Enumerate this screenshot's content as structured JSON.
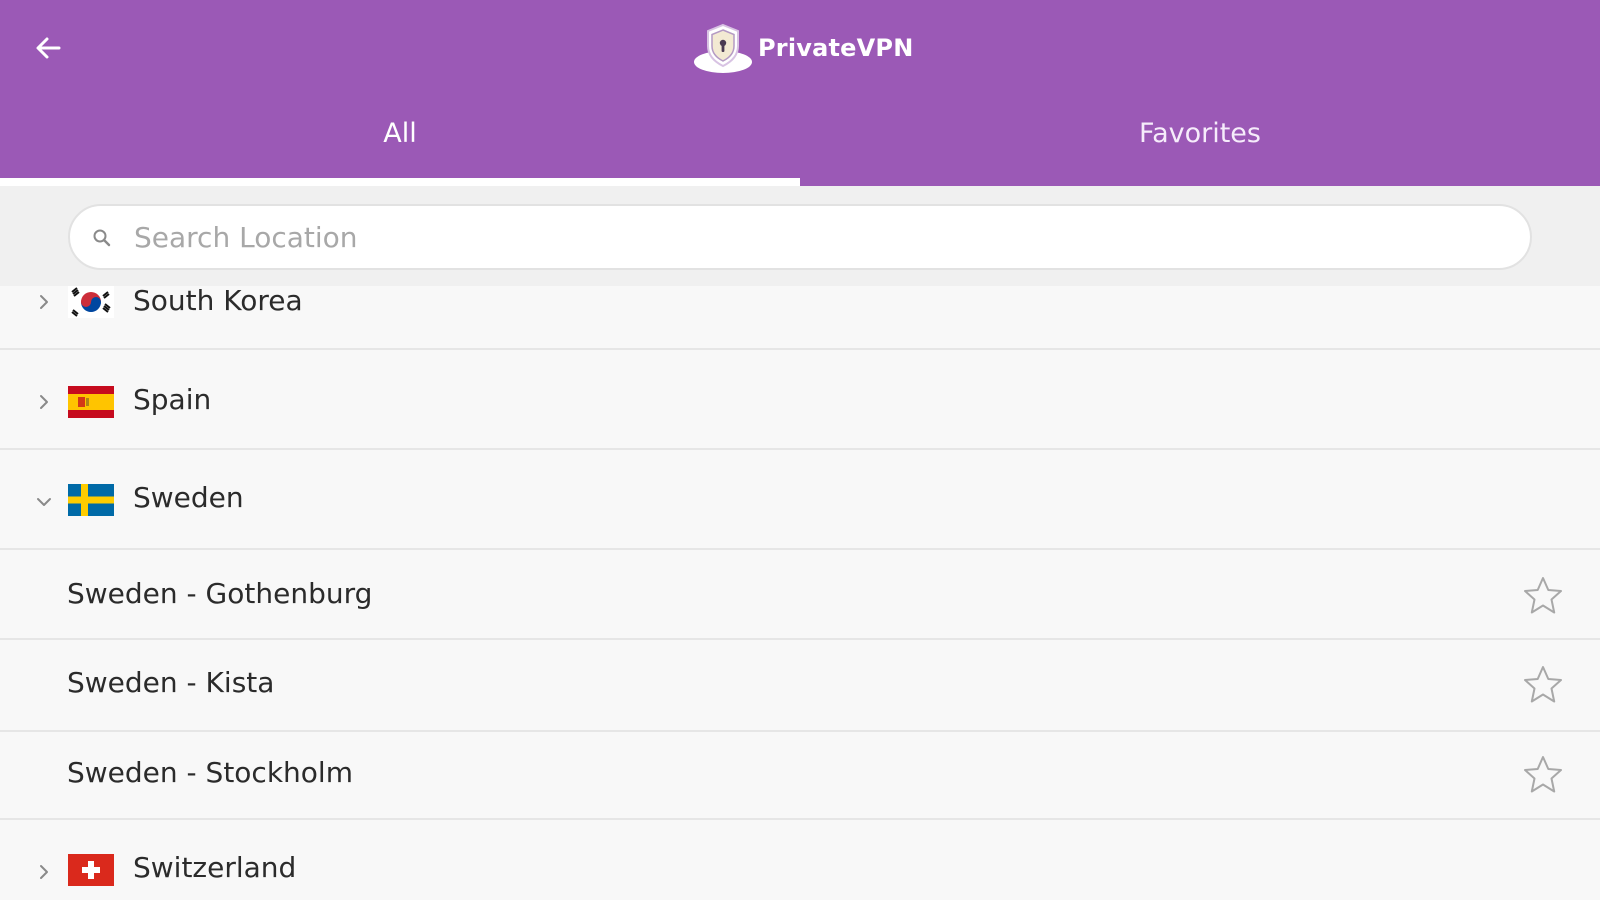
{
  "header": {
    "brand": "PrivateVPN",
    "accent_color": "#9b59b6",
    "back_icon": "arrow-left-icon",
    "logo_icon": "shield-lock-icon"
  },
  "tabs": [
    {
      "label": "All",
      "active": true
    },
    {
      "label": "Favorites",
      "active": false
    }
  ],
  "search": {
    "placeholder": "Search Location",
    "value": "",
    "icon": "search-icon"
  },
  "locations": [
    {
      "name": "South Korea",
      "flag": "south-korea-flag",
      "expanded": false
    },
    {
      "name": "Spain",
      "flag": "spain-flag",
      "expanded": false
    },
    {
      "name": "Sweden",
      "flag": "sweden-flag",
      "expanded": true,
      "servers": [
        {
          "name": "Sweden - Gothenburg",
          "favorite": false
        },
        {
          "name": "Sweden - Kista",
          "favorite": false
        },
        {
          "name": "Sweden - Stockholm",
          "favorite": false
        }
      ]
    },
    {
      "name": "Switzerland",
      "flag": "switzerland-flag",
      "expanded": false
    }
  ]
}
